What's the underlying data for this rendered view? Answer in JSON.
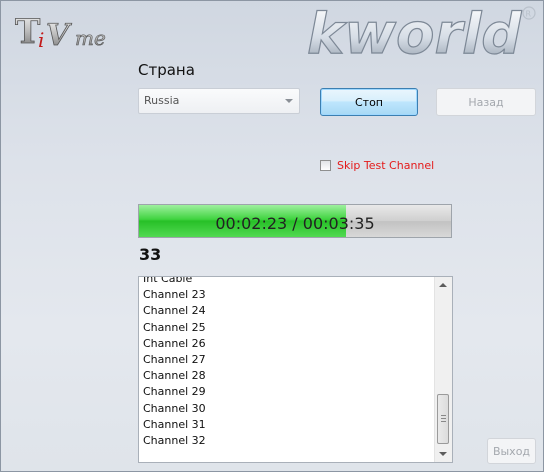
{
  "brand": {
    "tivme_logo_text": "TiVme",
    "kworld_logo_text": "kworld"
  },
  "country": {
    "label": "Страна",
    "selected": "Russia"
  },
  "buttons": {
    "stop_label": "Стоп",
    "back_label": "Назад",
    "exit_label": "Выход"
  },
  "skip_test": {
    "label": "Skip Test Channel",
    "checked": false,
    "color": "#e41b1b"
  },
  "progress": {
    "text": "00:02:23 / 00:03:35",
    "fraction": 0.665
  },
  "channel_count": "33",
  "channel_list": {
    "items": [
      "Int Cable",
      "Channel 23",
      "Channel 24",
      "Channel 25",
      "Channel 26",
      "Channel 27",
      "Channel 28",
      "Channel 29",
      "Channel 30",
      "Channel 31",
      "Channel 32"
    ]
  },
  "icons": {
    "select_arrow": "chevron-down-icon",
    "scroll_up": "arrow-up-icon",
    "scroll_down": "arrow-down-icon"
  }
}
